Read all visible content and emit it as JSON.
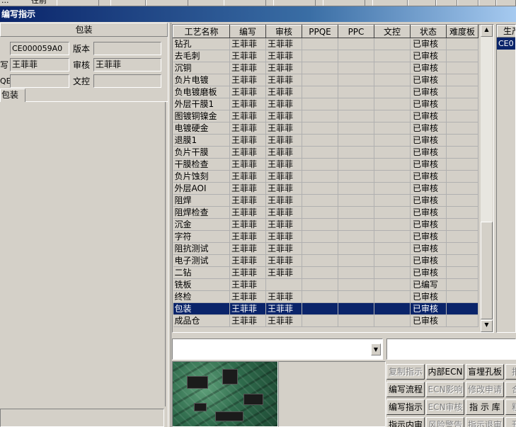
{
  "toolbar": {
    "left_text_1": "...",
    "left_text_2": "往前"
  },
  "window": {
    "title": "编写指示"
  },
  "left_panel": {
    "header": "包装",
    "code_value": "CE000059A0",
    "version_label": "版本",
    "version_value": "",
    "writer_label": "写",
    "writer_value": "王菲菲",
    "reviewer_label": "审核",
    "reviewer_value": "王菲菲",
    "pqe_label": "QE",
    "pqe_value": "",
    "doc_label": "文控",
    "doc_value": "",
    "tab_label": "包装"
  },
  "grid": {
    "columns": [
      "工艺名称",
      "编写",
      "审核",
      "PPQE",
      "PPC",
      "文控",
      "状态",
      "难度板"
    ],
    "selected_index": 22,
    "rows": [
      {
        "name": "钻孔",
        "writer": "王菲菲",
        "reviewer": "王菲菲",
        "status": "已审核"
      },
      {
        "name": "去毛刺",
        "writer": "王菲菲",
        "reviewer": "王菲菲",
        "status": "已审核"
      },
      {
        "name": "沉铜",
        "writer": "王菲菲",
        "reviewer": "王菲菲",
        "status": "已审核"
      },
      {
        "name": "负片电镀",
        "writer": "王菲菲",
        "reviewer": "王菲菲",
        "status": "已审核"
      },
      {
        "name": "负电镀磨板",
        "writer": "王菲菲",
        "reviewer": "王菲菲",
        "status": "已审核"
      },
      {
        "name": "外层干膜1",
        "writer": "王菲菲",
        "reviewer": "王菲菲",
        "status": "已审核"
      },
      {
        "name": "图镀铜镍金",
        "writer": "王菲菲",
        "reviewer": "王菲菲",
        "status": "已审核"
      },
      {
        "name": "电镀硬金",
        "writer": "王菲菲",
        "reviewer": "王菲菲",
        "status": "已审核"
      },
      {
        "name": "退膜1",
        "writer": "王菲菲",
        "reviewer": "王菲菲",
        "status": "已审核"
      },
      {
        "name": "负片干膜",
        "writer": "王菲菲",
        "reviewer": "王菲菲",
        "status": "已审核"
      },
      {
        "name": "干膜检查",
        "writer": "王菲菲",
        "reviewer": "王菲菲",
        "status": "已审核"
      },
      {
        "name": "负片蚀刻",
        "writer": "王菲菲",
        "reviewer": "王菲菲",
        "status": "已审核"
      },
      {
        "name": "外层AOI",
        "writer": "王菲菲",
        "reviewer": "王菲菲",
        "status": "已审核"
      },
      {
        "name": "阻焊",
        "writer": "王菲菲",
        "reviewer": "王菲菲",
        "status": "已审核"
      },
      {
        "name": "阻焊检查",
        "writer": "王菲菲",
        "reviewer": "王菲菲",
        "status": "已审核"
      },
      {
        "name": "沉金",
        "writer": "王菲菲",
        "reviewer": "王菲菲",
        "status": "已审核"
      },
      {
        "name": "字符",
        "writer": "王菲菲",
        "reviewer": "王菲菲",
        "status": "已审核"
      },
      {
        "name": "阻抗测试",
        "writer": "王菲菲",
        "reviewer": "王菲菲",
        "status": "已审核"
      },
      {
        "name": "电子测试",
        "writer": "王菲菲",
        "reviewer": "王菲菲",
        "status": "已审核"
      },
      {
        "name": "二钻",
        "writer": "王菲菲",
        "reviewer": "王菲菲",
        "status": "已审核"
      },
      {
        "name": "铣板",
        "writer": "王菲菲",
        "reviewer": "",
        "status": "已编写"
      },
      {
        "name": "终检",
        "writer": "王菲菲",
        "reviewer": "王菲菲",
        "status": "已审核"
      },
      {
        "name": "包装",
        "writer": "王菲菲",
        "reviewer": "王菲菲",
        "status": "已审核"
      },
      {
        "name": "成品仓",
        "writer": "王菲菲",
        "reviewer": "王菲菲",
        "status": "已审核"
      }
    ]
  },
  "right_panel": {
    "header": "生产",
    "row_value": "CE0"
  },
  "buttons": {
    "row1": [
      "复制指示",
      "内部ECN",
      "盲埋孔板",
      "报"
    ],
    "row2": [
      "编写流程",
      "ECN影响",
      "修改申请",
      "合"
    ],
    "row3": [
      "编写指示",
      "ECN审核",
      "指 示 库",
      "粗"
    ],
    "row4": [
      "指示内审",
      "风险警告",
      "指示退审",
      "刊"
    ],
    "disabled": {
      "row1": [
        true,
        false,
        false,
        true
      ],
      "row2": [
        false,
        true,
        true,
        true
      ],
      "row3": [
        false,
        true,
        false,
        true
      ],
      "row4": [
        false,
        true,
        true,
        true
      ]
    }
  },
  "colors": {
    "face": "#d4d0c8",
    "selection": "#0a246a",
    "title_start": "#0a246a"
  }
}
